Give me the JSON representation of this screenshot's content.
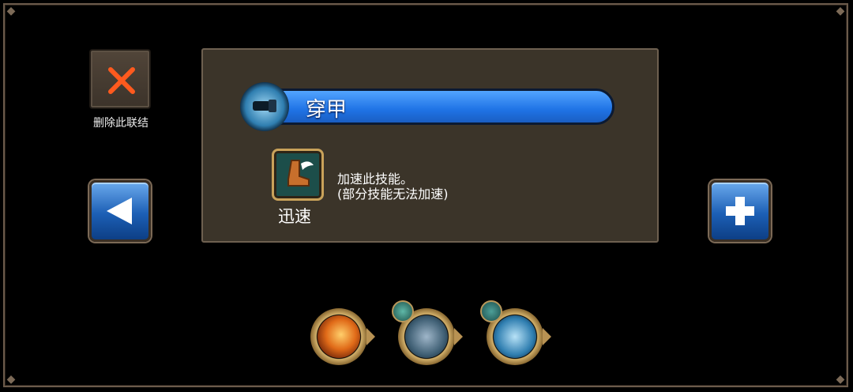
{
  "delete_link": {
    "label": "删除此联结",
    "icon": "close-x-icon",
    "icon_color": "#ff5a1e"
  },
  "nav": {
    "prev_icon": "left-arrow-icon",
    "add_icon": "plus-icon"
  },
  "skill": {
    "name": "穿甲",
    "icon": "armor-piercing-skill-icon",
    "bar_color": "#2f86f4"
  },
  "modifier": {
    "name": "迅速",
    "icon": "winged-boot-icon",
    "description_line1": "加速此技能。",
    "description_line2": "(部分技能无法加速)"
  },
  "chain": [
    {
      "icon": "fire-slash-skill-icon"
    },
    {
      "icon": "arcane-figure-skill-icon",
      "modifier_icon": "potion-icon"
    },
    {
      "icon": "armor-piercing-skill-icon",
      "modifier_icon": "winged-boot-icon"
    }
  ]
}
